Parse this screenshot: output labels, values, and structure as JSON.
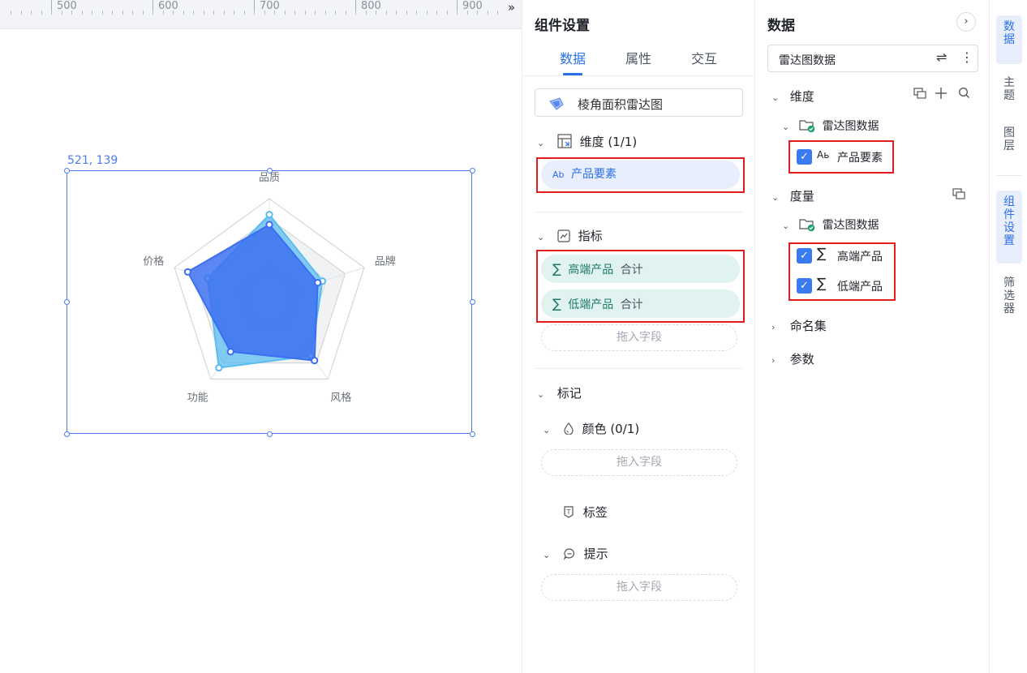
{
  "ruler": {
    "labels": [
      "500",
      "600",
      "700",
      "800",
      "900"
    ],
    "expand_glyph": "»"
  },
  "canvas": {
    "coord_label": "521, 139",
    "radar": {
      "axes": [
        "品质",
        "品牌",
        "风格",
        "功能",
        "价格"
      ],
      "series": [
        {
          "values": [
            0.84,
            0.56,
            0.71,
            0.86,
            0.65
          ],
          "color": "#5bbcf0"
        },
        {
          "values": [
            0.74,
            0.51,
            0.77,
            0.66,
            0.86
          ],
          "color": "#3b6ef0"
        }
      ],
      "ring_count": 5
    }
  },
  "settings": {
    "title": "组件设置",
    "tabs": [
      "数据",
      "属性",
      "交互"
    ],
    "active_tab": 0,
    "chart_type": "棱角面积雷达图",
    "dimension": {
      "header": "维度 (1/1)",
      "field": "产品要素",
      "field_prefix": "Ab"
    },
    "measure": {
      "header": "指标",
      "fields": [
        {
          "name": "高端产品",
          "agg": "合计"
        },
        {
          "name": "低端产品",
          "agg": "合计"
        }
      ],
      "drop_hint": "拖入字段"
    },
    "marks": {
      "header": "标记",
      "color": {
        "label": "颜色 (0/1)",
        "drop_hint": "拖入字段"
      },
      "label": {
        "label": "标签"
      },
      "tooltip": {
        "label": "提示",
        "drop_hint": "拖入字段"
      }
    }
  },
  "data_panel": {
    "title": "数据",
    "dataset": "雷达图数据",
    "dimension_group": "维度",
    "measure_group": "度量",
    "dataset_node": "雷达图数据",
    "dimension_fields": [
      "产品要素"
    ],
    "measure_fields": [
      "高端产品",
      "低端产品"
    ],
    "named_sets": "命名集",
    "params": "参数"
  },
  "rail": {
    "items": [
      "数据",
      "主题",
      "图层",
      "组件设置",
      "筛选器"
    ],
    "active": [
      0,
      3
    ]
  }
}
